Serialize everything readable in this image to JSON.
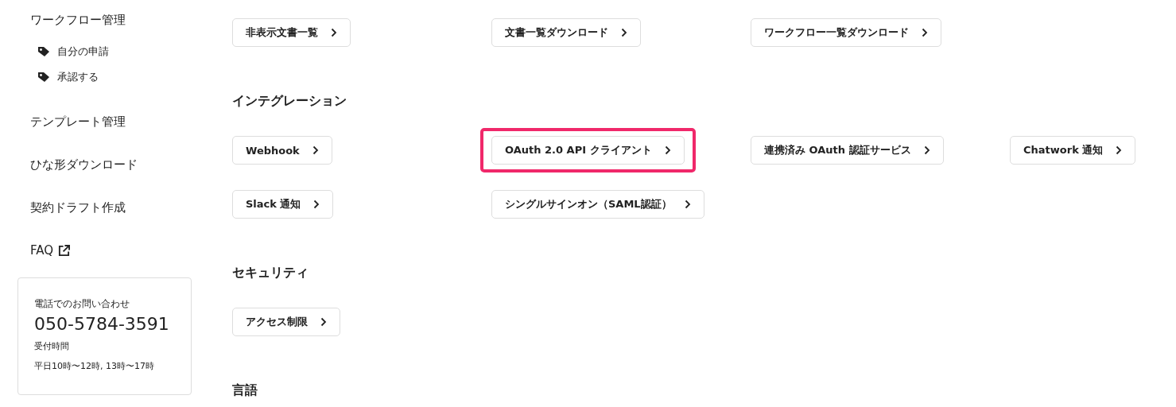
{
  "sidebar": {
    "items": [
      {
        "label": "ワークフロー管理",
        "children": [
          {
            "label": "自分の申請"
          },
          {
            "label": "承認する"
          }
        ]
      },
      {
        "label": "テンプレート管理"
      },
      {
        "label": "ひな形ダウンロード"
      },
      {
        "label": "契約ドラフト作成"
      },
      {
        "label": "FAQ",
        "external": true
      }
    ],
    "contact": {
      "title": "電話でのお問い合わせ",
      "phone": "050-5784-3591",
      "hours_label": "受付時間",
      "hours": "平日10時〜12時, 13時〜17時"
    }
  },
  "sections": [
    {
      "buttons": [
        {
          "label": "非表示文書一覧",
          "highlighted": false
        },
        {
          "label": "文書一覧ダウンロード",
          "highlighted": false
        },
        {
          "label": "ワークフロー一覧ダウンロード",
          "highlighted": false
        }
      ]
    },
    {
      "heading": "インテグレーション",
      "buttons": [
        {
          "label": "Webhook",
          "highlighted": false
        },
        {
          "label": "OAuth 2.0 API クライアント",
          "highlighted": true
        },
        {
          "label": "連携済み OAuth 認証サービス",
          "highlighted": false
        },
        {
          "label": "Chatwork 通知",
          "highlighted": false
        },
        {
          "label": "Slack 通知",
          "highlighted": false
        },
        {
          "label": "シングルサインオン（SAML認証）",
          "highlighted": false
        }
      ]
    },
    {
      "heading": "セキュリティ",
      "buttons": [
        {
          "label": "アクセス制限",
          "highlighted": false
        }
      ]
    },
    {
      "heading": "言語"
    }
  ]
}
